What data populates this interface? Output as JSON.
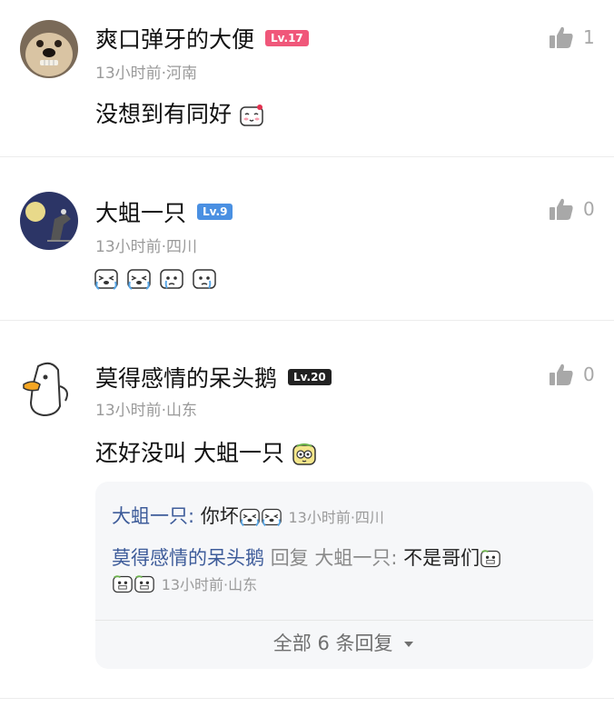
{
  "comments": [
    {
      "username": "爽口弹牙的大便",
      "level": "Lv.17",
      "level_color": "#f0577a",
      "meta": "13小时前·河南",
      "text": "没想到有同好",
      "likes": "1"
    },
    {
      "username": "大蛆一只",
      "level": "Lv.9",
      "level_color": "#4a90e2",
      "meta": "13小时前·四川",
      "text": "",
      "likes": "0"
    },
    {
      "username": "莫得感情的呆头鹅",
      "level": "Lv.20",
      "level_color": "#222222",
      "meta": "13小时前·山东",
      "text": "还好没叫  大蛆一只",
      "likes": "0"
    }
  ],
  "replies": [
    {
      "author": "大蛆一只:",
      "text": "你坏",
      "meta": "13小时前·四川"
    },
    {
      "author": "莫得感情的呆头鹅",
      "reply_word": "回复",
      "target": "大蛆一只:",
      "text": "不是哥们",
      "meta": "13小时前·山东"
    }
  ],
  "more_replies": "全部 6 条回复",
  "icons": {
    "like": "thumbs-up-icon",
    "expand": "caret-down-icon"
  }
}
